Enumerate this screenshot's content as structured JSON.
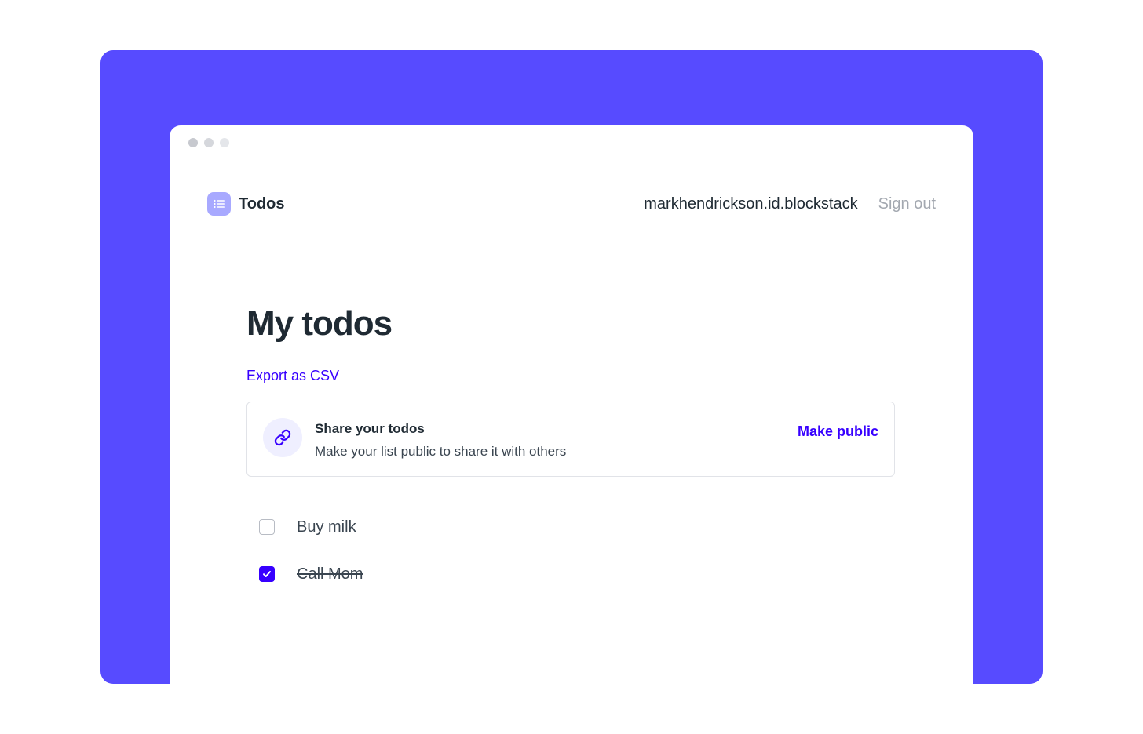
{
  "colors": {
    "accent": "#574bff",
    "link": "#3700ff",
    "text": "#1f2a33",
    "muted": "#a3a8b0"
  },
  "header": {
    "app_title": "Todos",
    "app_icon": "list-icon",
    "username": "markhendrickson.id.blockstack",
    "signout_label": "Sign out"
  },
  "main": {
    "title": "My todos",
    "export_label": "Export as CSV"
  },
  "share": {
    "icon": "link-icon",
    "title": "Share your todos",
    "description": "Make your list public to share it with others",
    "action_label": "Make public"
  },
  "todos": [
    {
      "label": "Buy milk",
      "done": false
    },
    {
      "label": "Call Mom",
      "done": true
    }
  ]
}
